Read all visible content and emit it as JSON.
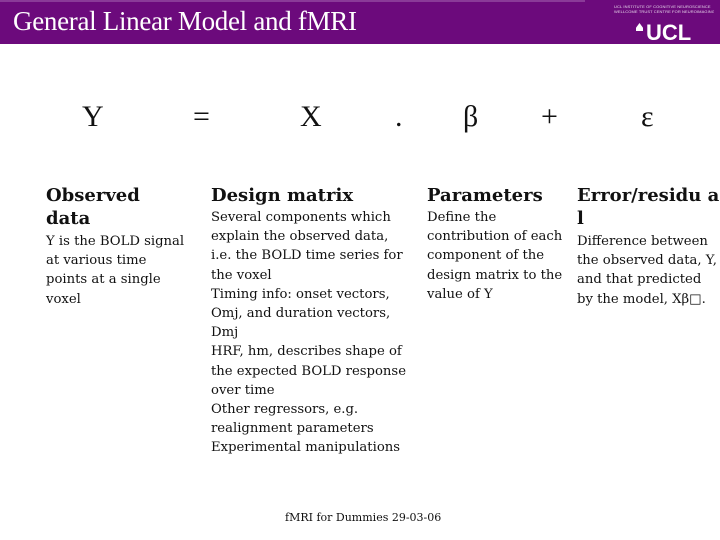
{
  "header": {
    "title": "General Linear Model and fMRI",
    "institute_line1": "UCL INSTITUTE OF COGNITIVE NEUROSCIENCE",
    "institute_line2": "WELLCOME TRUST CENTRE FOR NEUROIMAGING",
    "logo_text": "UCL",
    "background_color": "#6c0a7c"
  },
  "equation": {
    "y": "Y",
    "equals": "=",
    "x": "X",
    "dot": ".",
    "beta": "β",
    "plus": "+",
    "epsilon": "ε"
  },
  "columns": [
    {
      "heading": "Observed data",
      "body": "Y is the BOLD signal at various time points at a single voxel"
    },
    {
      "heading": "Design matrix",
      "body": "Several components which explain the observed data, i.e. the BOLD time series for the voxel\nTiming info: onset vectors, Omj, and duration vectors, Dmj\nHRF, hm, describes shape of the expected BOLD response over time\nOther regressors, e.g. realignment parameters\nExperimental manipulations"
    },
    {
      "heading": "Parameters",
      "body": "Define the contribution of each component of the design matrix to the value of Y"
    },
    {
      "heading": "Error/residual",
      "heading_display": "Error/residu al",
      "body": "Difference between the observed data, Y, and that predicted by the model, Xβ□."
    }
  ],
  "footer": "fMRI for Dummies 29-03-06"
}
